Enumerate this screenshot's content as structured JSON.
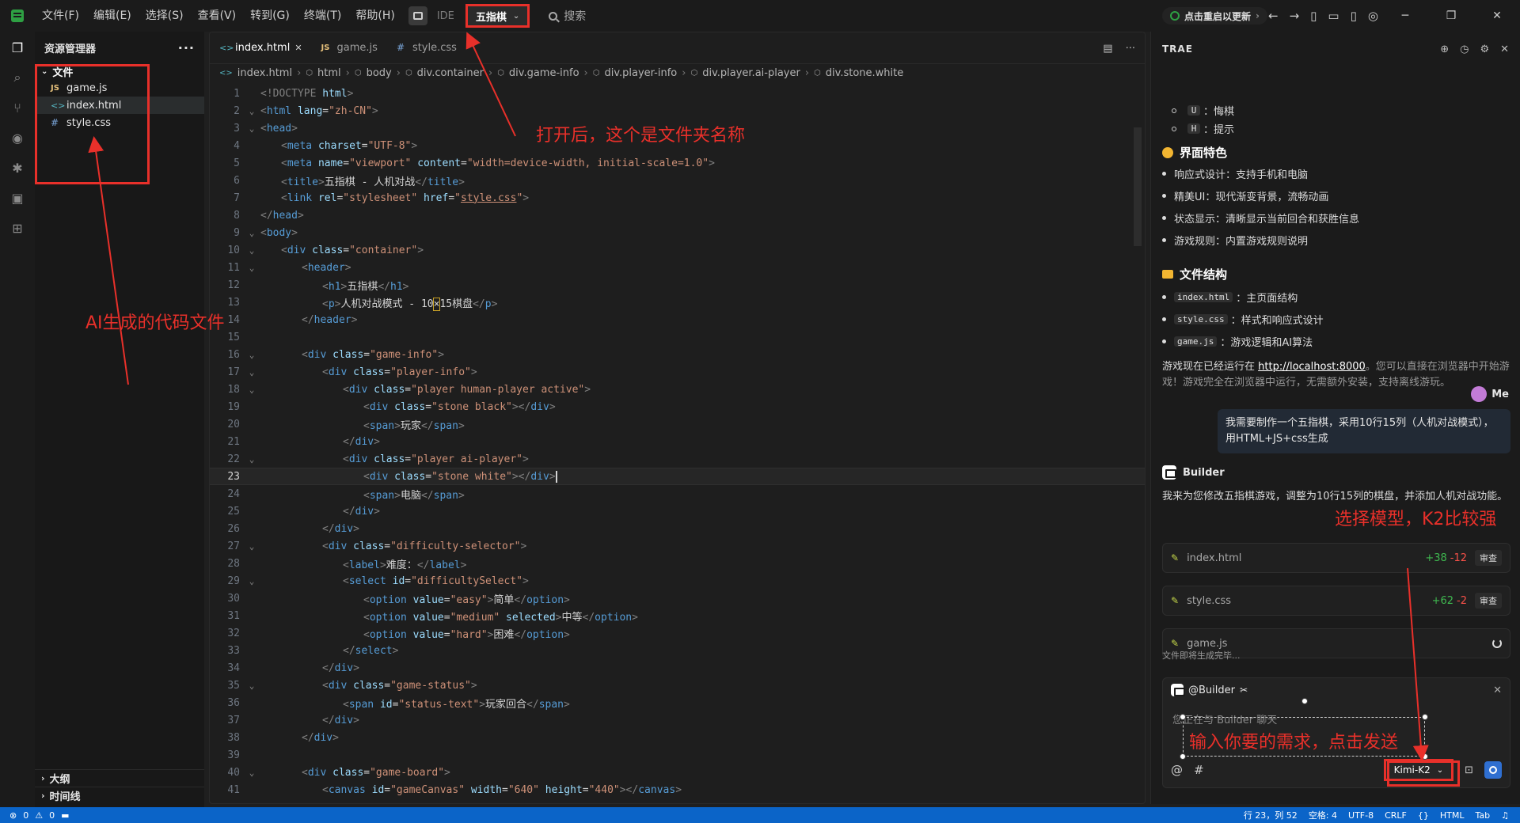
{
  "titlebar": {
    "menus": [
      "文件(F)",
      "编辑(E)",
      "选择(S)",
      "查看(V)",
      "转到(G)",
      "终端(T)",
      "帮助(H)"
    ],
    "ide_label": "IDE",
    "project_name": "五指棋",
    "search_label": "搜索",
    "update_label": "点击重启以更新"
  },
  "sidebar": {
    "title": "资源管理器",
    "folder": "文件",
    "files": [
      {
        "icon": "JS",
        "name": "game.js"
      },
      {
        "icon": "<>",
        "name": "index.html"
      },
      {
        "icon": "#",
        "name": "style.css"
      }
    ],
    "outline": "大纲",
    "timeline": "时间线"
  },
  "editor": {
    "tabs": [
      {
        "icon": "<>",
        "label": "index.html",
        "active": true
      },
      {
        "icon": "JS",
        "label": "game.js",
        "active": false
      },
      {
        "icon": "#",
        "label": "style.css",
        "active": false
      }
    ],
    "breadcrumb": [
      "index.html",
      "html",
      "body",
      "div.container",
      "div.game-info",
      "div.player-info",
      "div.player.ai-player",
      "div.stone.white"
    ],
    "current_line": 23,
    "lines": [
      {
        "n": "1",
        "fold": "",
        "indent": 0,
        "html": "<span style=\"color:#808080\">&lt;!DOCTYPE </span><span style=\"color:#9cdcfe\">html</span><span style=\"color:#808080\">&gt;</span>"
      },
      {
        "n": "2",
        "fold": "v",
        "indent": 0,
        "html": "<span style=\"color:#808080\">&lt;</span><span style=\"color:#569cd6\">html</span> <span style=\"color:#9cdcfe\">lang</span>=<span style=\"color:#ce9178\">\"zh-CN\"</span><span style=\"color:#808080\">&gt;</span>"
      },
      {
        "n": "3",
        "fold": "v",
        "indent": 0,
        "html": "<span style=\"color:#808080\">&lt;</span><span style=\"color:#569cd6\">head</span><span style=\"color:#808080\">&gt;</span>"
      },
      {
        "n": "4",
        "fold": "",
        "indent": 1,
        "html": "<span style=\"color:#808080\">&lt;</span><span style=\"color:#569cd6\">meta</span> <span style=\"color:#9cdcfe\">charset</span>=<span style=\"color:#ce9178\">\"UTF-8\"</span><span style=\"color:#808080\">&gt;</span>"
      },
      {
        "n": "5",
        "fold": "",
        "indent": 1,
        "html": "<span style=\"color:#808080\">&lt;</span><span style=\"color:#569cd6\">meta</span> <span style=\"color:#9cdcfe\">name</span>=<span style=\"color:#ce9178\">\"viewport\"</span> <span style=\"color:#9cdcfe\">content</span>=<span style=\"color:#ce9178\">\"width=device-width, initial-scale=1.0\"</span><span style=\"color:#808080\">&gt;</span>"
      },
      {
        "n": "6",
        "fold": "",
        "indent": 1,
        "html": "<span style=\"color:#808080\">&lt;</span><span style=\"color:#569cd6\">title</span><span style=\"color:#808080\">&gt;</span>五指棋 - 人机对战<span style=\"color:#808080\">&lt;/</span><span style=\"color:#569cd6\">title</span><span style=\"color:#808080\">&gt;</span>"
      },
      {
        "n": "7",
        "fold": "",
        "indent": 1,
        "html": "<span style=\"color:#808080\">&lt;</span><span style=\"color:#569cd6\">link</span> <span style=\"color:#9cdcfe\">rel</span>=<span style=\"color:#ce9178\">\"stylesheet\"</span> <span style=\"color:#9cdcfe\">href</span>=<span style=\"color:#ce9178\">\"<u>style.css</u>\"</span><span style=\"color:#808080\">&gt;</span>"
      },
      {
        "n": "8",
        "fold": "",
        "indent": 0,
        "html": "<span style=\"color:#808080\">&lt;/</span><span style=\"color:#569cd6\">head</span><span style=\"color:#808080\">&gt;</span>"
      },
      {
        "n": "9",
        "fold": "v",
        "indent": 0,
        "html": "<span style=\"color:#808080\">&lt;</span><span style=\"color:#569cd6\">body</span><span style=\"color:#808080\">&gt;</span>"
      },
      {
        "n": "10",
        "fold": "v",
        "indent": 1,
        "html": "<span style=\"color:#808080\">&lt;</span><span style=\"color:#569cd6\">div</span> <span style=\"color:#9cdcfe\">class</span>=<span style=\"color:#ce9178\">\"container\"</span><span style=\"color:#808080\">&gt;</span>"
      },
      {
        "n": "11",
        "fold": "v",
        "indent": 2,
        "html": "<span style=\"color:#808080\">&lt;</span><span style=\"color:#569cd6\">header</span><span style=\"color:#808080\">&gt;</span>"
      },
      {
        "n": "12",
        "fold": "",
        "indent": 3,
        "html": "<span style=\"color:#808080\">&lt;</span><span style=\"color:#569cd6\">h1</span><span style=\"color:#808080\">&gt;</span>五指棋<span style=\"color:#808080\">&lt;/</span><span style=\"color:#569cd6\">h1</span><span style=\"color:#808080\">&gt;</span>"
      },
      {
        "n": "13",
        "fold": "",
        "indent": 3,
        "html": "<span style=\"color:#808080\">&lt;</span><span style=\"color:#569cd6\">p</span><span style=\"color:#808080\">&gt;</span>人机对战模式 - 10<span style=\"outline:1px solid #c9a227\">×</span>15棋盘<span style=\"color:#808080\">&lt;/</span><span style=\"color:#569cd6\">p</span><span style=\"color:#808080\">&gt;</span>"
      },
      {
        "n": "14",
        "fold": "",
        "indent": 2,
        "html": "<span style=\"color:#808080\">&lt;/</span><span style=\"color:#569cd6\">header</span><span style=\"color:#808080\">&gt;</span>"
      },
      {
        "n": "15",
        "fold": "",
        "indent": 0,
        "html": ""
      },
      {
        "n": "16",
        "fold": "v",
        "indent": 2,
        "html": "<span style=\"color:#808080\">&lt;</span><span style=\"color:#569cd6\">div</span> <span style=\"color:#9cdcfe\">class</span>=<span style=\"color:#ce9178\">\"game-info\"</span><span style=\"color:#808080\">&gt;</span>"
      },
      {
        "n": "17",
        "fold": "v",
        "indent": 3,
        "html": "<span style=\"color:#808080\">&lt;</span><span style=\"color:#569cd6\">div</span> <span style=\"color:#9cdcfe\">class</span>=<span style=\"color:#ce9178\">\"player-info\"</span><span style=\"color:#808080\">&gt;</span>"
      },
      {
        "n": "18",
        "fold": "v",
        "indent": 4,
        "html": "<span style=\"color:#808080\">&lt;</span><span style=\"color:#569cd6\">div</span> <span style=\"color:#9cdcfe\">class</span>=<span style=\"color:#ce9178\">\"player human-player active\"</span><span style=\"color:#808080\">&gt;</span>"
      },
      {
        "n": "19",
        "fold": "",
        "indent": 5,
        "html": "<span style=\"color:#808080\">&lt;</span><span style=\"color:#569cd6\">div</span> <span style=\"color:#9cdcfe\">class</span>=<span style=\"color:#ce9178\">\"stone black\"</span><span style=\"color:#808080\">&gt;&lt;/</span><span style=\"color:#569cd6\">div</span><span style=\"color:#808080\">&gt;</span>"
      },
      {
        "n": "20",
        "fold": "",
        "indent": 5,
        "html": "<span style=\"color:#808080\">&lt;</span><span style=\"color:#569cd6\">span</span><span style=\"color:#808080\">&gt;</span>玩家<span style=\"color:#808080\">&lt;/</span><span style=\"color:#569cd6\">span</span><span style=\"color:#808080\">&gt;</span>"
      },
      {
        "n": "21",
        "fold": "",
        "indent": 4,
        "html": "<span style=\"color:#808080\">&lt;/</span><span style=\"color:#569cd6\">div</span><span style=\"color:#808080\">&gt;</span>"
      },
      {
        "n": "22",
        "fold": "v",
        "indent": 4,
        "html": "<span style=\"color:#808080\">&lt;</span><span style=\"color:#569cd6\">div</span> <span style=\"color:#9cdcfe\">class</span>=<span style=\"color:#ce9178\">\"player ai-player\"</span><span style=\"color:#808080\">&gt;</span>"
      },
      {
        "n": "23",
        "fold": "",
        "indent": 5,
        "html": "<span style=\"color:#808080\">&lt;</span><span style=\"color:#569cd6\">div</span> <span style=\"color:#9cdcfe\">class</span>=<span style=\"color:#ce9178\">\"stone white\"</span><span style=\"color:#808080\">&gt;&lt;/</span><span style=\"color:#569cd6\">div</span><span style=\"color:#808080\">&gt;</span><span style=\"border-left:2px solid #d4d4d4\">&#8203;</span>"
      },
      {
        "n": "24",
        "fold": "",
        "indent": 5,
        "html": "<span style=\"color:#808080\">&lt;</span><span style=\"color:#569cd6\">span</span><span style=\"color:#808080\">&gt;</span>电脑<span style=\"color:#808080\">&lt;/</span><span style=\"color:#569cd6\">span</span><span style=\"color:#808080\">&gt;</span>"
      },
      {
        "n": "25",
        "fold": "",
        "indent": 4,
        "html": "<span style=\"color:#808080\">&lt;/</span><span style=\"color:#569cd6\">div</span><span style=\"color:#808080\">&gt;</span>"
      },
      {
        "n": "26",
        "fold": "",
        "indent": 3,
        "html": "<span style=\"color:#808080\">&lt;/</span><span style=\"color:#569cd6\">div</span><span style=\"color:#808080\">&gt;</span>"
      },
      {
        "n": "27",
        "fold": "v",
        "indent": 3,
        "html": "<span style=\"color:#808080\">&lt;</span><span style=\"color:#569cd6\">div</span> <span style=\"color:#9cdcfe\">class</span>=<span style=\"color:#ce9178\">\"difficulty-selector\"</span><span style=\"color:#808080\">&gt;</span>"
      },
      {
        "n": "28",
        "fold": "",
        "indent": 4,
        "html": "<span style=\"color:#808080\">&lt;</span><span style=\"color:#569cd6\">label</span><span style=\"color:#808080\">&gt;</span>难度：<span style=\"color:#808080\">&lt;/</span><span style=\"color:#569cd6\">label</span><span style=\"color:#808080\">&gt;</span>"
      },
      {
        "n": "29",
        "fold": "v",
        "indent": 4,
        "html": "<span style=\"color:#808080\">&lt;</span><span style=\"color:#569cd6\">select</span> <span style=\"color:#9cdcfe\">id</span>=<span style=\"color:#ce9178\">\"difficultySelect\"</span><span style=\"color:#808080\">&gt;</span>"
      },
      {
        "n": "30",
        "fold": "",
        "indent": 5,
        "html": "<span style=\"color:#808080\">&lt;</span><span style=\"color:#569cd6\">option</span> <span style=\"color:#9cdcfe\">value</span>=<span style=\"color:#ce9178\">\"easy\"</span><span style=\"color:#808080\">&gt;</span>简单<span style=\"color:#808080\">&lt;/</span><span style=\"color:#569cd6\">option</span><span style=\"color:#808080\">&gt;</span>"
      },
      {
        "n": "31",
        "fold": "",
        "indent": 5,
        "html": "<span style=\"color:#808080\">&lt;</span><span style=\"color:#569cd6\">option</span> <span style=\"color:#9cdcfe\">value</span>=<span style=\"color:#ce9178\">\"medium\"</span> <span style=\"color:#9cdcfe\">selected</span><span style=\"color:#808080\">&gt;</span>中等<span style=\"color:#808080\">&lt;/</span><span style=\"color:#569cd6\">option</span><span style=\"color:#808080\">&gt;</span>"
      },
      {
        "n": "32",
        "fold": "",
        "indent": 5,
        "html": "<span style=\"color:#808080\">&lt;</span><span style=\"color:#569cd6\">option</span> <span style=\"color:#9cdcfe\">value</span>=<span style=\"color:#ce9178\">\"hard\"</span><span style=\"color:#808080\">&gt;</span>困难<span style=\"color:#808080\">&lt;/</span><span style=\"color:#569cd6\">option</span><span style=\"color:#808080\">&gt;</span>"
      },
      {
        "n": "33",
        "fold": "",
        "indent": 4,
        "html": "<span style=\"color:#808080\">&lt;/</span><span style=\"color:#569cd6\">select</span><span style=\"color:#808080\">&gt;</span>"
      },
      {
        "n": "34",
        "fold": "",
        "indent": 3,
        "html": "<span style=\"color:#808080\">&lt;/</span><span style=\"color:#569cd6\">div</span><span style=\"color:#808080\">&gt;</span>"
      },
      {
        "n": "35",
        "fold": "v",
        "indent": 3,
        "html": "<span style=\"color:#808080\">&lt;</span><span style=\"color:#569cd6\">div</span> <span style=\"color:#9cdcfe\">class</span>=<span style=\"color:#ce9178\">\"game-status\"</span><span style=\"color:#808080\">&gt;</span>"
      },
      {
        "n": "36",
        "fold": "",
        "indent": 4,
        "html": "<span style=\"color:#808080\">&lt;</span><span style=\"color:#569cd6\">span</span> <span style=\"color:#9cdcfe\">id</span>=<span style=\"color:#ce9178\">\"status-text\"</span><span style=\"color:#808080\">&gt;</span>玩家回合<span style=\"color:#808080\">&lt;/</span><span style=\"color:#569cd6\">span</span><span style=\"color:#808080\">&gt;</span>"
      },
      {
        "n": "37",
        "fold": "",
        "indent": 3,
        "html": "<span style=\"color:#808080\">&lt;/</span><span style=\"color:#569cd6\">div</span><span style=\"color:#808080\">&gt;</span>"
      },
      {
        "n": "38",
        "fold": "",
        "indent": 2,
        "html": "<span style=\"color:#808080\">&lt;/</span><span style=\"color:#569cd6\">div</span><span style=\"color:#808080\">&gt;</span>"
      },
      {
        "n": "39",
        "fold": "",
        "indent": 0,
        "html": ""
      },
      {
        "n": "40",
        "fold": "v",
        "indent": 2,
        "html": "<span style=\"color:#808080\">&lt;</span><span style=\"color:#569cd6\">div</span> <span style=\"color:#9cdcfe\">class</span>=<span style=\"color:#ce9178\">\"game-board\"</span><span style=\"color:#808080\">&gt;</span>"
      },
      {
        "n": "41",
        "fold": "",
        "indent": 3,
        "html": "<span style=\"color:#808080\">&lt;</span><span style=\"color:#569cd6\">canvas</span> <span style=\"color:#9cdcfe\">id</span>=<span style=\"color:#ce9178\">\"gameCanvas\"</span> <span style=\"color:#9cdcfe\">width</span>=<span style=\"color:#ce9178\">\"640\"</span> <span style=\"color:#9cdcfe\">height</span>=<span style=\"color:#ce9178\">\"440\"</span><span style=\"color:#808080\">&gt;&lt;/</span><span style=\"color:#569cd6\">canvas</span><span style=\"color:#808080\">&gt;</span>"
      }
    ]
  },
  "chat": {
    "title": "TRAE",
    "shortcuts": [
      {
        "key": "U",
        "label": "：悔棋"
      },
      {
        "key": "H",
        "label": "：提示"
      }
    ],
    "features_title": "界面特色",
    "features": [
      "响应式设计：支持手机和电脑",
      "精美UI：现代渐变背景，流畅动画",
      "状态显示：清晰显示当前回合和获胜信息",
      "游戏规则：内置游戏规则说明"
    ],
    "structure_title": "文件结构",
    "structure": [
      {
        "file": "index.html",
        "desc": "：主页面结构"
      },
      {
        "file": "style.css",
        "desc": "：样式和响应式设计"
      },
      {
        "file": "game.js",
        "desc": "：游戏逻辑和AI算法"
      }
    ],
    "running_prefix": "游戏现在已经运行在 ",
    "running_link": "http://localhost:8000",
    "running_suffix": "。您可以直接在浏览器中开始游戏！游戏完全在浏览器中运行，无需额外安装，支持离线游玩。",
    "me_label": "Me",
    "user_message": "我需要制作一个五指棋，采用10行15列（人机对战模式），用HTML+JS+css生成",
    "builder_label": "Builder",
    "builder_message": "我来为您修改五指棋游戏，调整为10行15列的棋盘，并添加人机对战功能。",
    "file_changes": [
      {
        "name": "index.html",
        "add": "+38",
        "del": "-12",
        "action": "审查"
      },
      {
        "name": "style.css",
        "add": "+62",
        "del": "-2",
        "action": "审查"
      },
      {
        "name": "game.js",
        "add": "",
        "del": "",
        "action": ""
      }
    ],
    "generating": "文件即将生成完毕...",
    "input_agent": "@Builder",
    "input_placeholder": "您正在与 Builder 聊天",
    "model": "Kimi-K2"
  },
  "status": {
    "errors": "0",
    "warnings": "0",
    "position": "行 23，列 52",
    "spaces": "空格: 4",
    "encoding": "UTF-8",
    "eol": "CRLF",
    "braces": "{}",
    "language": "HTML",
    "tab": "Tab"
  },
  "annotations": {
    "folder_note": "打开后，这个是文件夹名称",
    "files_note": "AI生成的代码文件",
    "model_note": "选择模型，K2比较强",
    "input_note": "输入你要的需求，点击发送"
  },
  "colors": {
    "annotation": "#e8302a",
    "accent": "#3794ff",
    "status_bar": "#0b64c8"
  }
}
